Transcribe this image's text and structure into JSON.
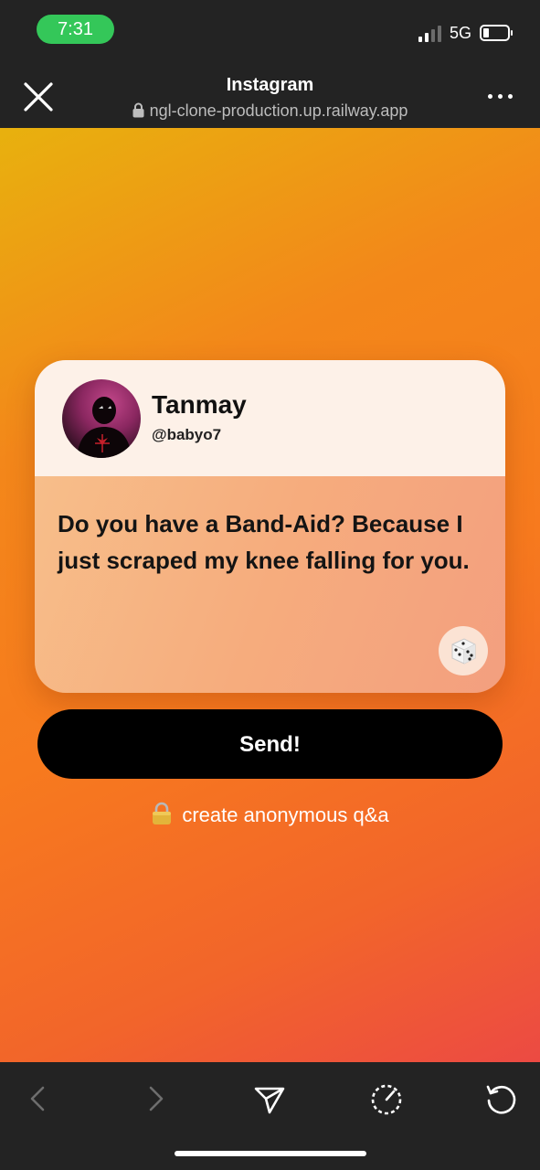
{
  "status_bar": {
    "time": "7:31",
    "network": "5G",
    "time_pill_color": "#34c759"
  },
  "browser": {
    "title": "Instagram",
    "url": "ngl-clone-production.up.railway.app",
    "close_icon": "close-icon",
    "more_icon": "more-horizontal-icon"
  },
  "card": {
    "display_name": "Tanmay",
    "username": "@babyo7",
    "question": "Do you have a Band-Aid? Because I just scraped my knee falling for you.",
    "dice_icon": "dice-icon"
  },
  "actions": {
    "send_label": "Send!",
    "create_link_label": "create anonymous q&a",
    "create_link_icon": "lock-icon"
  },
  "toolbar": {
    "icons": [
      "back-arrow-icon",
      "forward-arrow-icon",
      "share-icon",
      "timer-icon",
      "refresh-icon"
    ]
  },
  "colors": {
    "gradient_start": "#e8b10e",
    "gradient_mid": "#f77a1e",
    "gradient_end": "#ec4a43",
    "send_button": "#000000"
  }
}
